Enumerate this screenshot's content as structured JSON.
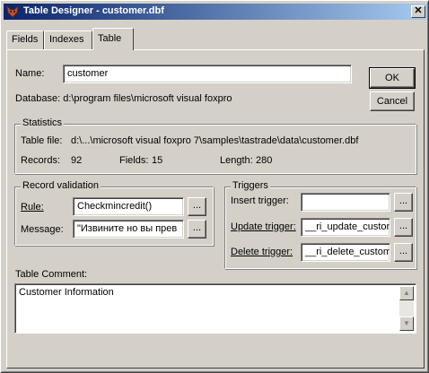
{
  "window": {
    "title": "Table Designer - customer.dbf",
    "close_glyph": "✕"
  },
  "tabs": [
    {
      "label": "Fields"
    },
    {
      "label": "Indexes"
    },
    {
      "label": "Table"
    }
  ],
  "active_tab": "Table",
  "name": {
    "label": "Name:",
    "value": "customer"
  },
  "database": {
    "text": "Database: d:\\program files\\microsoft visual foxpro"
  },
  "buttons": {
    "ok": "OK",
    "cancel": "Cancel"
  },
  "statistics": {
    "title": "Statistics",
    "table_file_label": "Table file:",
    "table_file_value": "d:\\...\\microsoft visual foxpro 7\\samples\\tastrade\\data\\customer.dbf",
    "records_label": "Records:",
    "records_value": "92",
    "fields_label": "Fields:",
    "fields_value": "15",
    "length_label": "Length:",
    "length_value": "280"
  },
  "record_validation": {
    "title": "Record validation",
    "rule_label": "Rule:",
    "rule_value": "Checkmincredit()",
    "message_label": "Message:",
    "message_value": "\"Извините но вы прев"
  },
  "triggers": {
    "title": "Triggers",
    "insert_label": "Insert trigger:",
    "insert_value": "",
    "update_label": "Update trigger:",
    "update_value": "__ri_update_custon",
    "delete_label": "Delete trigger:",
    "delete_value": "__ri_delete_custom"
  },
  "ellipsis": "...",
  "comment": {
    "label": "Table Comment:",
    "value": "Customer Information"
  },
  "scroll": {
    "up": "▲",
    "down": "▼"
  }
}
